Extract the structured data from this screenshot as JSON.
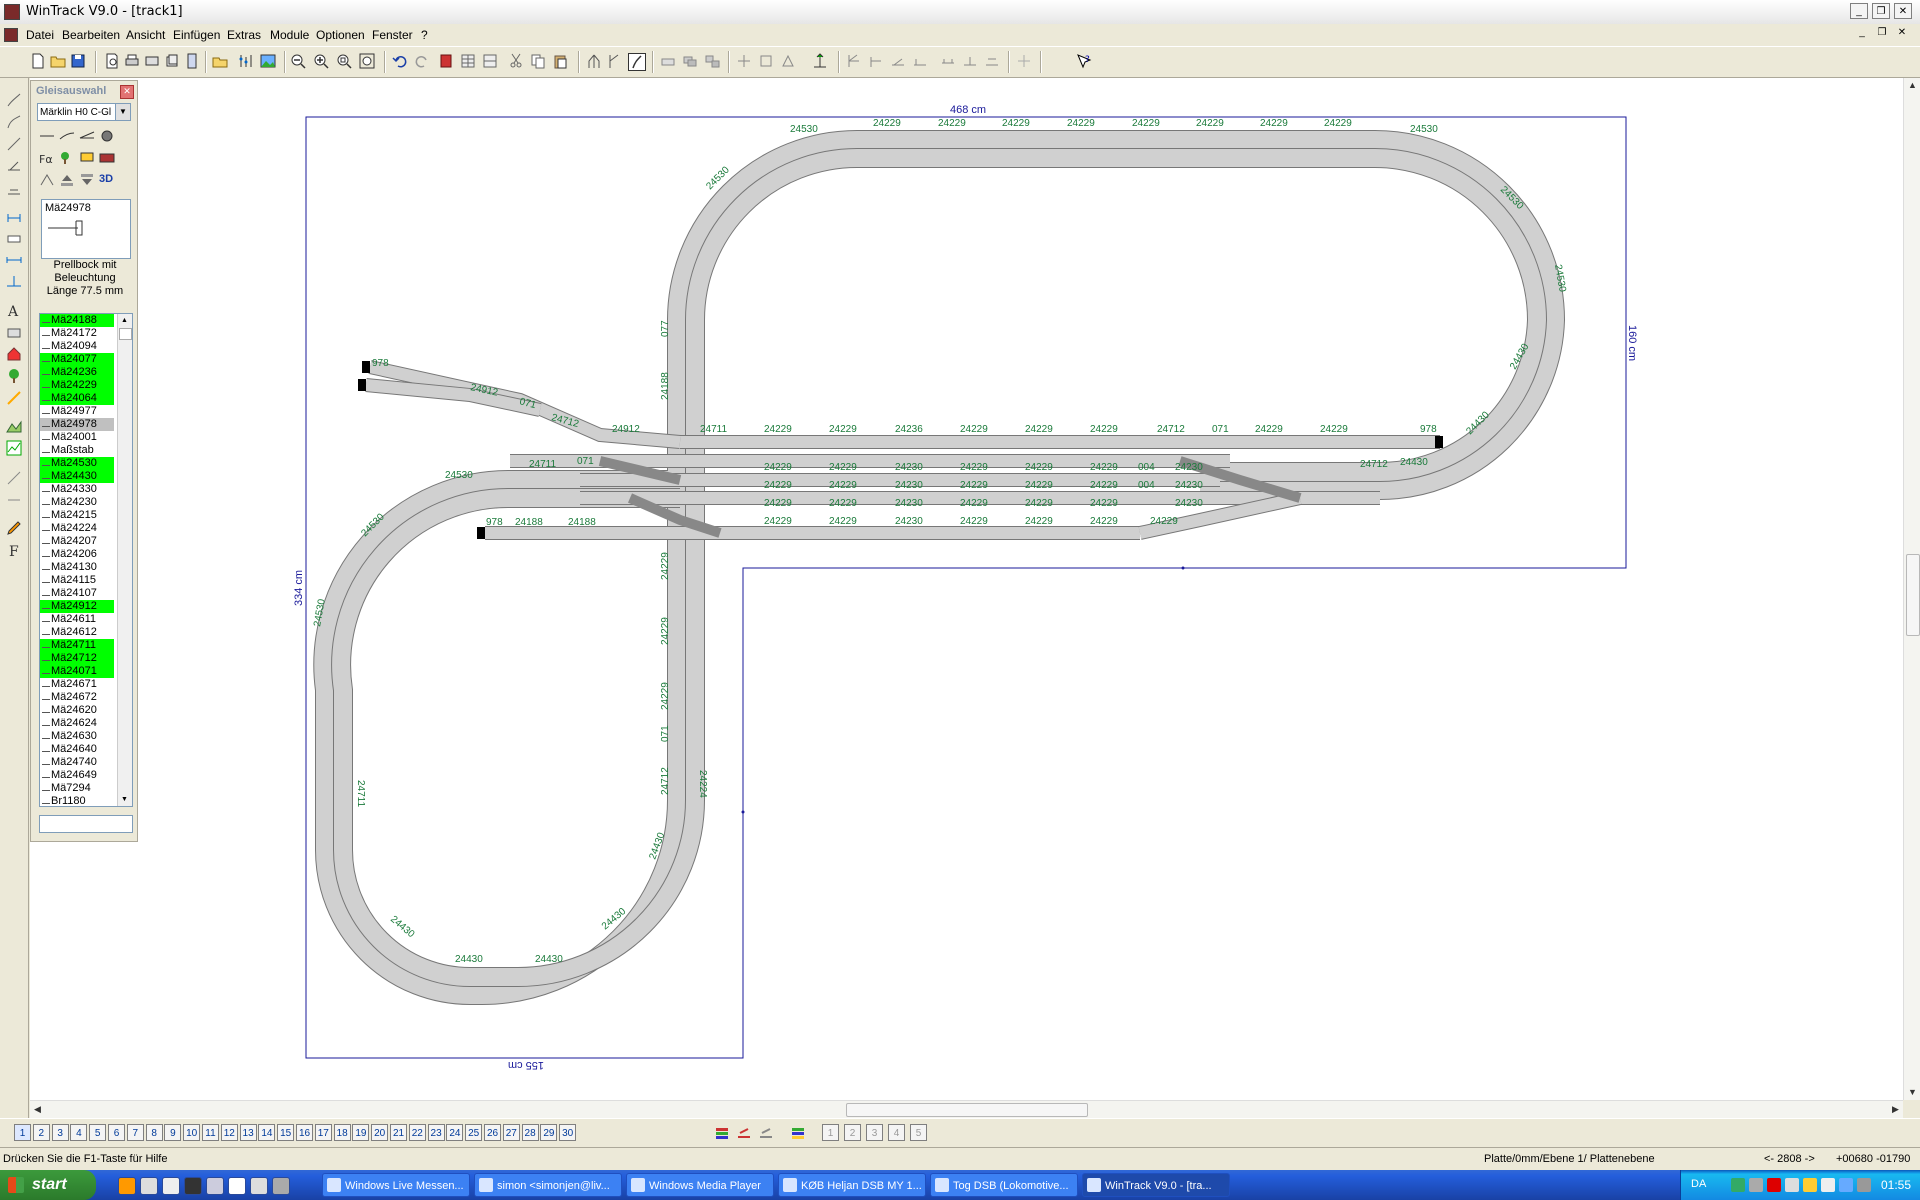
{
  "window": {
    "title": "WinTrack  V9.0 - [track1]"
  },
  "menu": [
    "Datei",
    "Bearbeiten",
    "Ansicht",
    "Einfügen",
    "Extras",
    "Module",
    "Optionen",
    "Fenster",
    "?"
  ],
  "panel": {
    "title": "Gleisauswahl",
    "category": "Märklin H0 C-Gl",
    "preview_part": "Mä24978",
    "description": [
      "Prellbock mit",
      "Beleuchtung",
      "Länge 77.5 mm"
    ],
    "parts": [
      {
        "name": "Mä24188",
        "highlight": true
      },
      {
        "name": "Mä24172",
        "highlight": false
      },
      {
        "name": "Mä24094",
        "highlight": false
      },
      {
        "name": "Mä24077",
        "highlight": true
      },
      {
        "name": "Mä24236",
        "highlight": true
      },
      {
        "name": "Mä24229",
        "highlight": true
      },
      {
        "name": "Mä24064",
        "highlight": true
      },
      {
        "name": "Mä24977",
        "highlight": false
      },
      {
        "name": "Mä24978",
        "highlight": false,
        "selected": true
      },
      {
        "name": "Mä24001",
        "highlight": false
      },
      {
        "name": "Maßstab",
        "highlight": false
      },
      {
        "name": "Mä24530",
        "highlight": true
      },
      {
        "name": "Mä24430",
        "highlight": true
      },
      {
        "name": "Mä24330",
        "highlight": false
      },
      {
        "name": "Mä24230",
        "highlight": false
      },
      {
        "name": "Mä24215",
        "highlight": false
      },
      {
        "name": "Mä24224",
        "highlight": false
      },
      {
        "name": "Mä24207",
        "highlight": false
      },
      {
        "name": "Mä24206",
        "highlight": false
      },
      {
        "name": "Mä24130",
        "highlight": false
      },
      {
        "name": "Mä24115",
        "highlight": false
      },
      {
        "name": "Mä24107",
        "highlight": false
      },
      {
        "name": "Mä24912",
        "highlight": true
      },
      {
        "name": "Mä24611",
        "highlight": false
      },
      {
        "name": "Mä24612",
        "highlight": false
      },
      {
        "name": "Mä24711",
        "highlight": true
      },
      {
        "name": "Mä24712",
        "highlight": true
      },
      {
        "name": "Mä24071",
        "highlight": true
      },
      {
        "name": "Mä24671",
        "highlight": false
      },
      {
        "name": "Mä24672",
        "highlight": false
      },
      {
        "name": "Mä24620",
        "highlight": false
      },
      {
        "name": "Mä24624",
        "highlight": false
      },
      {
        "name": "Mä24630",
        "highlight": false
      },
      {
        "name": "Mä24640",
        "highlight": false
      },
      {
        "name": "Mä24740",
        "highlight": false
      },
      {
        "name": "Mä24649",
        "highlight": false
      },
      {
        "name": "Mä7294",
        "highlight": false
      },
      {
        "name": "Br1180",
        "highlight": false
      }
    ]
  },
  "layout": {
    "dim_top": "468 cm",
    "dim_right": "160 cm",
    "dim_left": "334 cm",
    "dim_bottom": "155 cm",
    "track_color": "#cccccc",
    "label_color": "#1a7a3a",
    "frame_color": "#1a1a9a",
    "labels_straight": [
      "24229",
      "24229",
      "24229",
      "24229",
      "24229",
      "24229",
      "24229",
      "24229"
    ],
    "label_curve": "24530",
    "label_curve2": "24430",
    "label_switch_r": "24711",
    "label_switch_l": "24712",
    "label_slip": "24912",
    "label_buffer": "978",
    "label_straight_short": "24188",
    "label_straight_236": "24236",
    "label_straight_230": "24230",
    "label_crossing": "071",
    "label_crossing_b": "077",
    "label_curve_224": "24224",
    "label_004": "004"
  },
  "layers": [
    "1",
    "2",
    "3",
    "4",
    "5",
    "6",
    "7",
    "8",
    "9",
    "10",
    "11",
    "12",
    "13",
    "14",
    "15",
    "16",
    "17",
    "18",
    "19",
    "20",
    "21",
    "22",
    "23",
    "24",
    "25",
    "26",
    "27",
    "28",
    "29",
    "30"
  ],
  "layer_groups": [
    "1",
    "2",
    "3",
    "4",
    "5"
  ],
  "status": {
    "help": "Drücken Sie die  F1-Taste für Hilfe",
    "plate": "Platte/0mm/Ebene 1/ Plattenebene",
    "nav": "<- 2808 ->",
    "coords": "+00680  -01790"
  },
  "taskbar": {
    "start": "start",
    "tasks": [
      {
        "label": "Windows Live Messen...",
        "active": false
      },
      {
        "label": "simon <simonjen@liv...",
        "active": false
      },
      {
        "label": "Windows Media Player",
        "active": false
      },
      {
        "label": "KØB Heljan DSB MY 1...",
        "active": false
      },
      {
        "label": "Tog DSB (Lokomotive...",
        "active": false
      },
      {
        "label": "WinTrack  V9.0 - [tra...",
        "active": true
      }
    ],
    "lang": "DA",
    "clock": "01:55"
  }
}
